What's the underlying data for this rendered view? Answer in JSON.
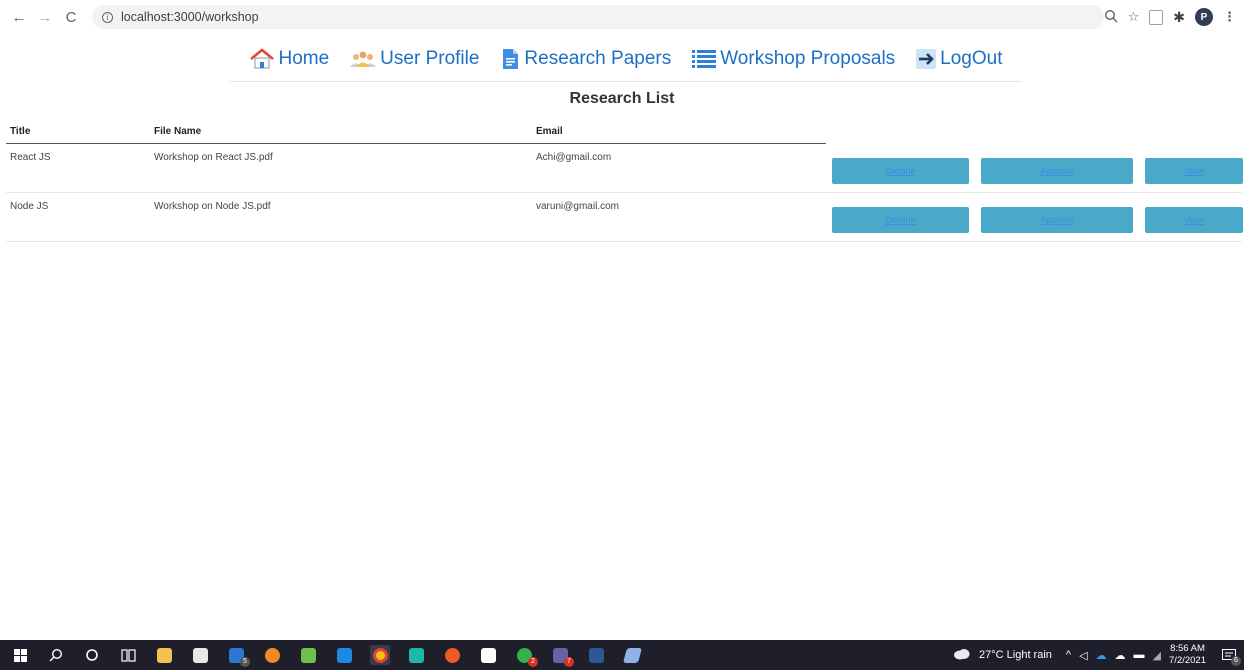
{
  "browser": {
    "url": "localhost:3000/workshop",
    "avatar_letter": "P"
  },
  "nav": {
    "items": [
      {
        "label": "Home",
        "icon": "house-icon"
      },
      {
        "label": "User Profile",
        "icon": "users-icon"
      },
      {
        "label": "Research Papers",
        "icon": "document-icon"
      },
      {
        "label": "Workshop Proposals",
        "icon": "list-icon"
      },
      {
        "label": "LogOut",
        "icon": "arrow-right-icon"
      }
    ]
  },
  "main": {
    "heading": "Research List",
    "columns": [
      "Title",
      "File Name",
      "Email"
    ],
    "rows": [
      {
        "title": "React JS",
        "file_name": "Workshop on React JS.pdf",
        "email": "Achi@gmail.com"
      },
      {
        "title": "Node JS",
        "file_name": "Workshop on Node JS.pdf",
        "email": "varuni@gmail.com"
      }
    ],
    "actions": {
      "decline": "Decline",
      "approve": "Approve",
      "view": "View"
    }
  },
  "taskbar": {
    "weather": "27°C  Light rain",
    "time": "8:56 AM",
    "date": "7/2/2021",
    "notification_count": "6",
    "badges": {
      "mail": "5",
      "chat": "2",
      "teams": "7"
    }
  },
  "colors": {
    "nav_link": "#1e6fc4",
    "button_bg": "#4aa8c9",
    "button_text": "#3b8ee0",
    "taskbar_bg": "#1f1f2b"
  }
}
